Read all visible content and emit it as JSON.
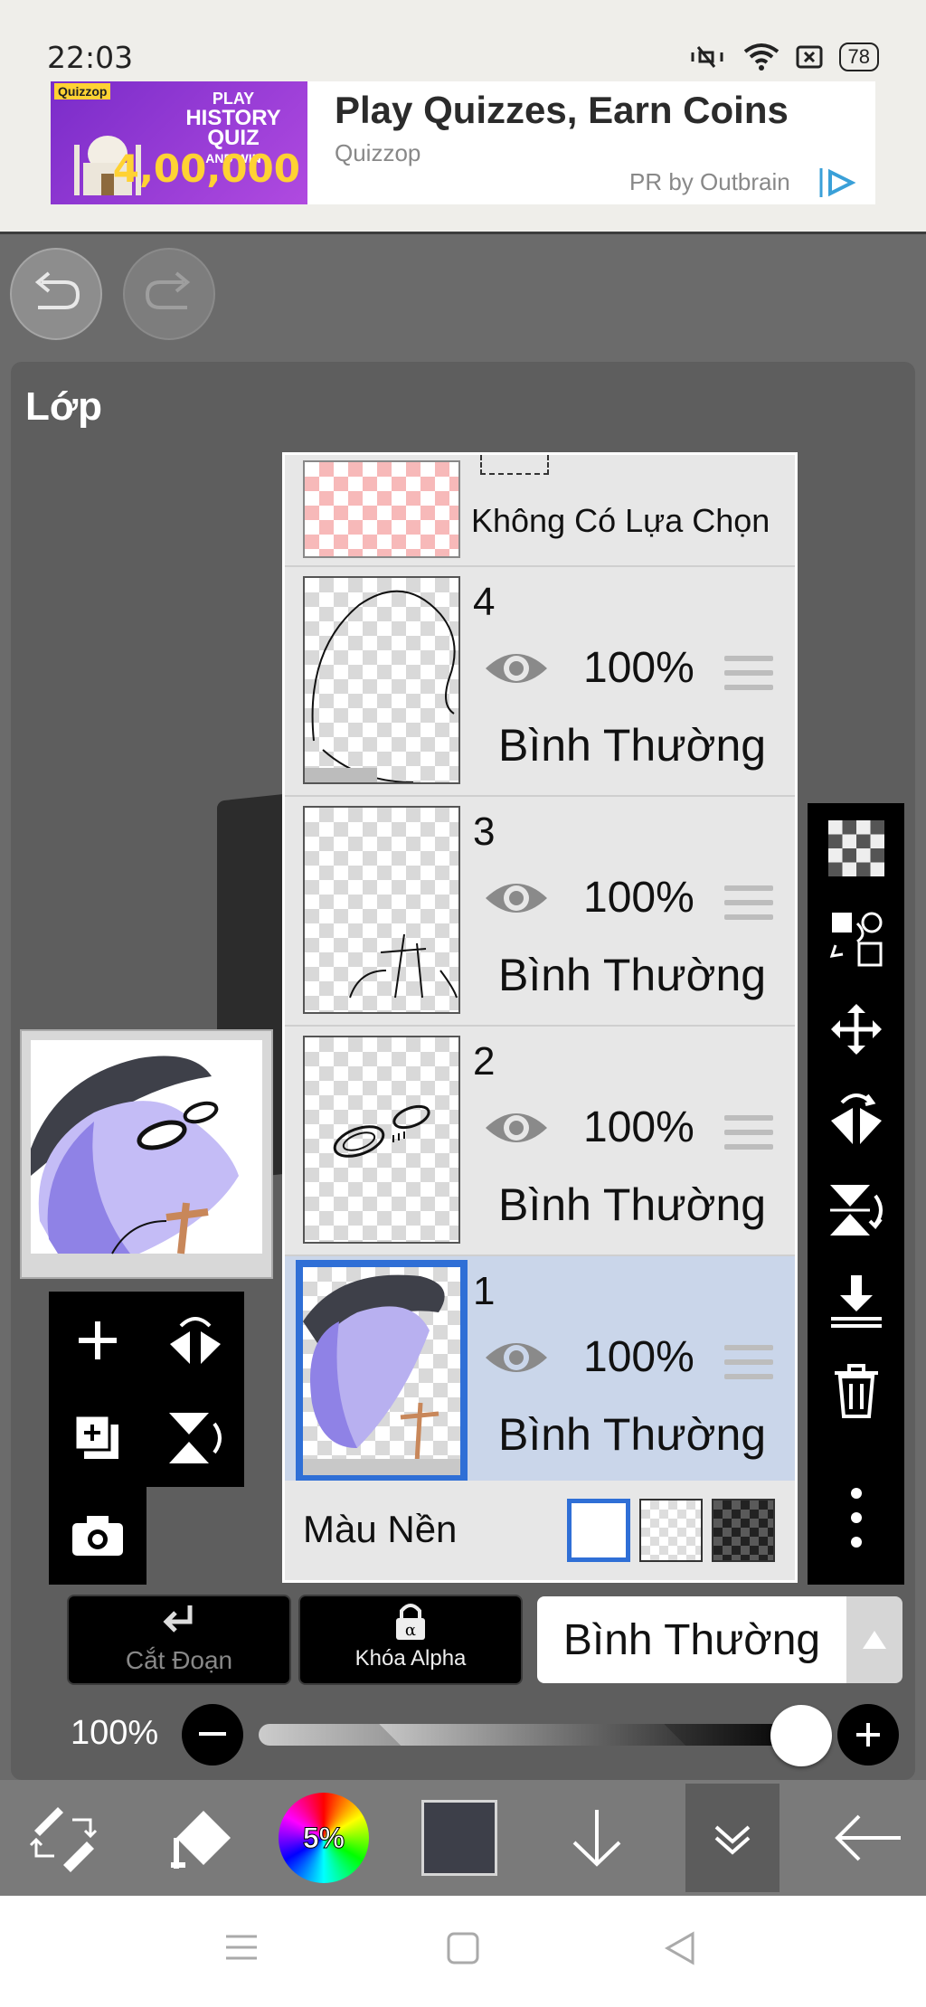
{
  "status": {
    "time": "22:03",
    "battery": "78"
  },
  "ad": {
    "image_top": "PLAY",
    "image_mid": "HISTORY QUIZ",
    "image_and": "AND WIN",
    "image_amount": "4,00,000",
    "image_brand": "Quizzop",
    "title": "Play Quizzes, Earn Coins",
    "brand": "Quizzop",
    "attribution": "PR by Outbrain"
  },
  "panel": {
    "title": "Lớp"
  },
  "selection_row": {
    "label": "Không Có Lựa Chọn"
  },
  "layers": [
    {
      "num": "4",
      "opacity": "100%",
      "blend": "Bình Thường",
      "selected": false
    },
    {
      "num": "3",
      "opacity": "100%",
      "blend": "Bình Thường",
      "selected": false
    },
    {
      "num": "2",
      "opacity": "100%",
      "blend": "Bình Thường",
      "selected": false
    },
    {
      "num": "1",
      "opacity": "100%",
      "blend": "Bình Thường",
      "selected": true
    }
  ],
  "background_row": {
    "label": "Màu Nền"
  },
  "actions": {
    "clipping": "Cắt Đoạn",
    "alpha_lock": "Khóa Alpha",
    "blend_mode": "Bình Thường"
  },
  "opacity": {
    "label": "100%",
    "value": 1.0
  },
  "bottom": {
    "color_wheel_label": "5%",
    "current_color": "#3d3f49"
  },
  "colors": {
    "selection_blue": "#2f6fd6",
    "selected_row": "#cad6ea",
    "panel_bg": "#5e5e5e"
  }
}
